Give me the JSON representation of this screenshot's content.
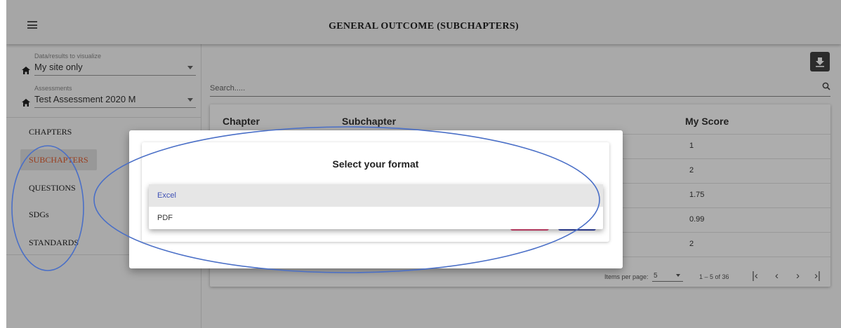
{
  "toolbar": {
    "title": "GENERAL OUTCOME (SUBCHAPTERS)"
  },
  "sidebar": {
    "data_field": {
      "label": "Data/results to visualize",
      "value": "My site only"
    },
    "assessment_field": {
      "label": "Assessments",
      "value": "Test Assessment 2020 M"
    },
    "items": [
      {
        "label": "CHAPTERS"
      },
      {
        "label": "SUBCHAPTERS"
      },
      {
        "label": "QUESTIONS"
      },
      {
        "label": "SDGs"
      },
      {
        "label": "STANDARDS"
      }
    ]
  },
  "main": {
    "search_placeholder": "Search.....",
    "table": {
      "headers": [
        "Chapter",
        "Subchapter",
        "My Score"
      ],
      "scores": [
        "1",
        "2",
        "1.75",
        "0.99",
        "2"
      ]
    },
    "paginator": {
      "items_per_page_label": "Items per page:",
      "page_size": "5",
      "range": "1 – 5 of 36"
    }
  },
  "dialog": {
    "title": "Select your format",
    "options": [
      "Excel",
      "PDF"
    ],
    "selected": "Excel"
  },
  "colors": {
    "accent": "#3f51b5",
    "active_nav": "#e35a2b",
    "cancel": "#e84a7a",
    "ok": "#3649b0",
    "annotation": "#4a6fc7"
  },
  "icons": [
    "menu-icon",
    "home-icon",
    "dropdown-caret-icon",
    "download-icon",
    "search-icon"
  ]
}
